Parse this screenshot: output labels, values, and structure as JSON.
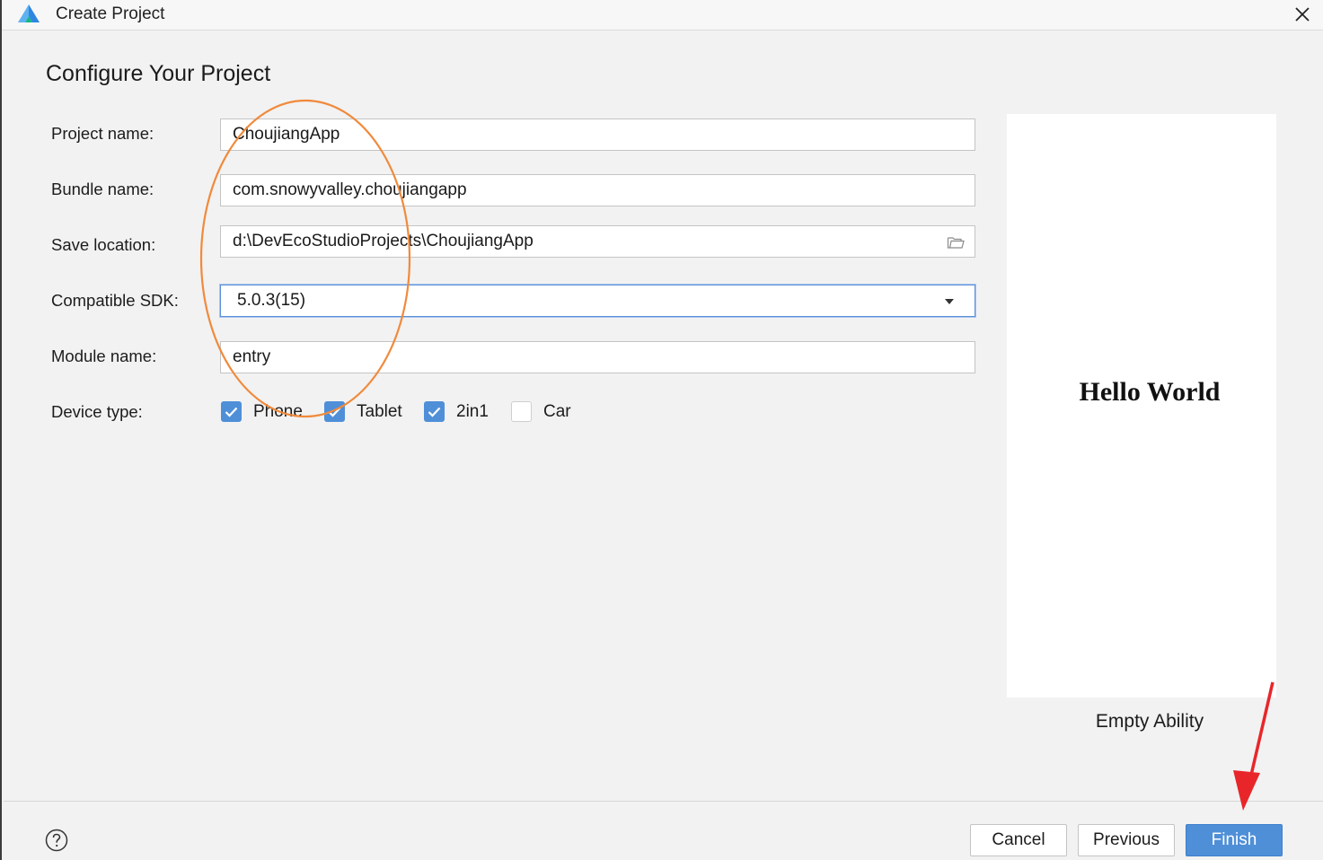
{
  "window": {
    "title": "Create Project",
    "close_icon": "close-icon",
    "logo_icon": "deveco-logo-icon"
  },
  "page": {
    "heading": "Configure Your Project"
  },
  "form": {
    "project_name": {
      "label": "Project name:",
      "value": "ChoujiangApp"
    },
    "bundle_name": {
      "label": "Bundle name:",
      "value": "com.snowyvalley.choujiangapp"
    },
    "save_location": {
      "label": "Save location:",
      "value": "d:\\DevEcoStudioProjects\\ChoujiangApp",
      "icon": "folder-icon"
    },
    "compatible_sdk": {
      "label": "Compatible SDK:",
      "value": "5.0.3(15)",
      "icon": "chevron-down-icon"
    },
    "module_name": {
      "label": "Module name:",
      "value": "entry"
    },
    "device_type": {
      "label": "Device type:",
      "options": [
        {
          "label": "Phone",
          "checked": true
        },
        {
          "label": "Tablet",
          "checked": true
        },
        {
          "label": "2in1",
          "checked": true
        },
        {
          "label": "Car",
          "checked": false
        }
      ]
    }
  },
  "preview": {
    "text": "Hello World",
    "template_name": "Empty Ability"
  },
  "footer": {
    "help_icon": "help-icon",
    "cancel_label": "Cancel",
    "previous_label": "Previous",
    "finish_label": "Finish"
  },
  "colors": {
    "accent": "#4f8fd8",
    "annotation_ellipse": "#f08a3c",
    "annotation_arrow": "#e8262a"
  }
}
